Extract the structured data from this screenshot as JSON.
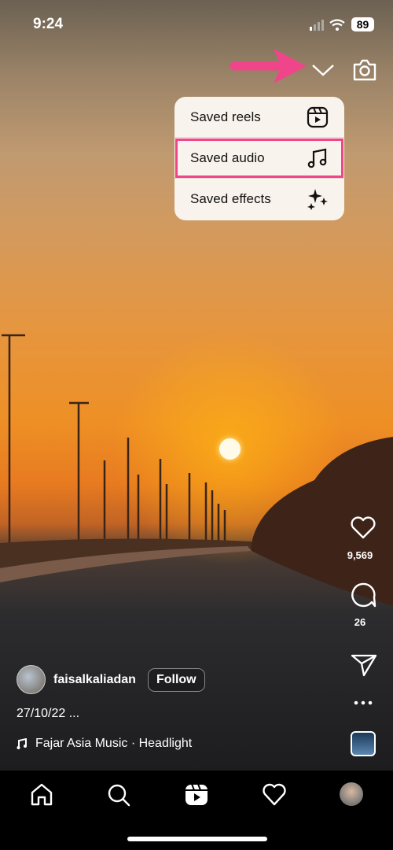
{
  "status_bar": {
    "time": "9:24",
    "battery": "89"
  },
  "top": {
    "chevron_icon": "chevron-down-icon",
    "camera_icon": "camera-icon",
    "annotation_arrow_color": "#f0458a"
  },
  "menu": {
    "items": [
      {
        "label": "Saved reels",
        "icon": "reels-icon"
      },
      {
        "label": "Saved audio",
        "icon": "music-note-icon",
        "highlighted": true
      },
      {
        "label": "Saved effects",
        "icon": "sparkles-icon"
      }
    ],
    "highlight_color": "#f0458a"
  },
  "actions": {
    "likes": "9,569",
    "comments": "26"
  },
  "post": {
    "username": "faisalkaliadan",
    "follow_label": "Follow",
    "caption": "27/10/22 ...",
    "audio": "Fajar Asia Music · Headlight"
  },
  "nav": {
    "items": [
      "home-icon",
      "search-icon",
      "reels-icon",
      "heart-icon",
      "profile-avatar"
    ]
  }
}
